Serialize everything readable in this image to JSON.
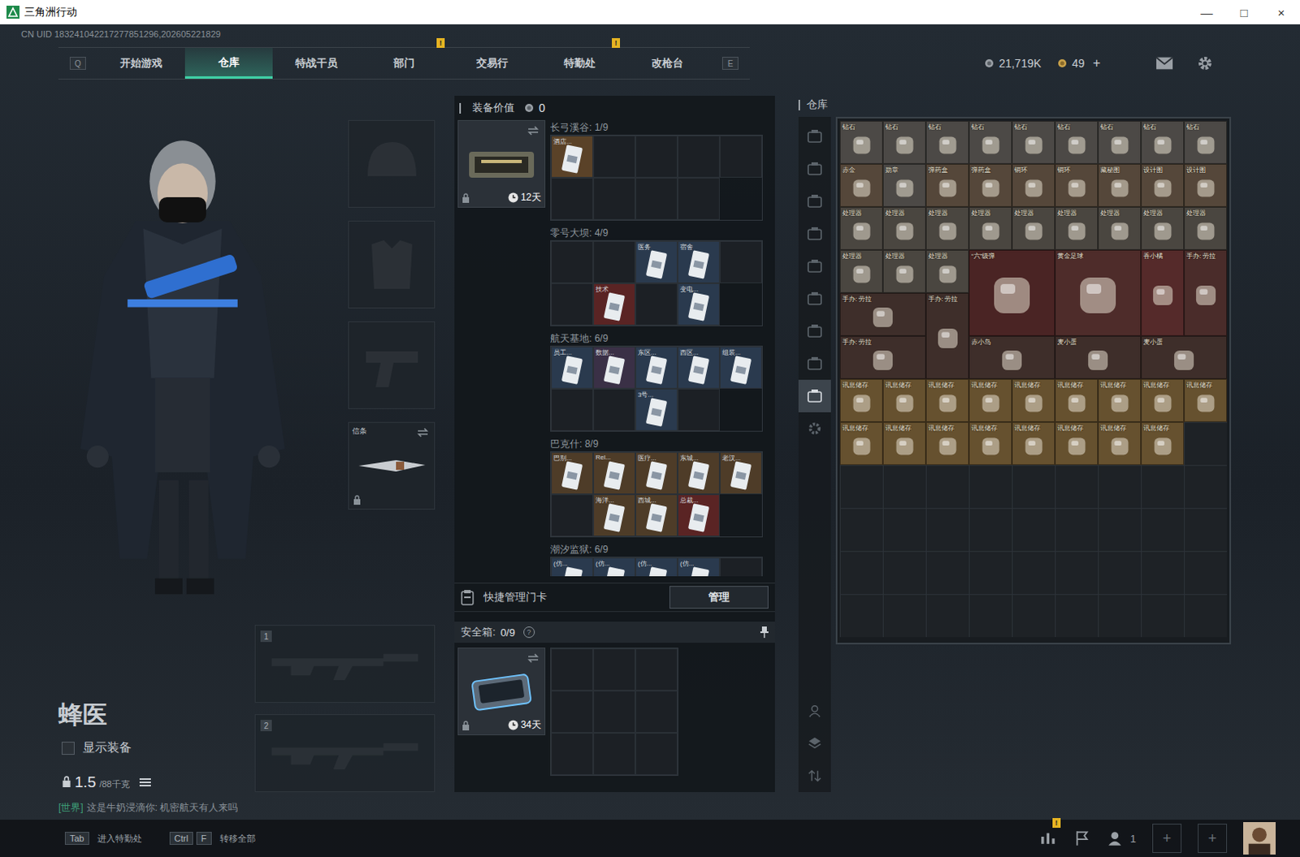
{
  "window": {
    "title": "三角洲行动",
    "controls": [
      "—",
      "□",
      "×"
    ]
  },
  "uid": "CN UID 183241042217277851296,202605221829",
  "nav": {
    "left_key": "Q",
    "right_key": "E",
    "alert_mark": "!",
    "tabs": [
      {
        "label": "开始游戏",
        "selected": false,
        "alert": false
      },
      {
        "label": "仓库",
        "selected": true,
        "alert": false
      },
      {
        "label": "特战干员",
        "selected": false,
        "alert": false
      },
      {
        "label": "部门",
        "selected": false,
        "alert": true
      },
      {
        "label": "交易行",
        "selected": false,
        "alert": false
      },
      {
        "label": "特勤处",
        "selected": false,
        "alert": true
      },
      {
        "label": "改枪台",
        "selected": false,
        "alert": false
      }
    ]
  },
  "currency": {
    "coins": "21,719K",
    "tickets": "49",
    "add": "+"
  },
  "operator": {
    "name": "蜂医",
    "show_equipment": {
      "label": "显示装备",
      "checked": false
    },
    "weight": "1.5",
    "weight_max": "/88千克"
  },
  "chat": {
    "channel": "[世界]",
    "message": "这是牛奶浸滴你: 机密航天有人来吗"
  },
  "equipment": {
    "slots": [
      {
        "kind": "helmet",
        "label": "",
        "locked": false
      },
      {
        "kind": "armor",
        "label": "",
        "locked": false
      },
      {
        "kind": "pistol",
        "label": "",
        "locked": false
      },
      {
        "kind": "melee",
        "label": "信条",
        "locked": true
      }
    ],
    "weapons": [
      {
        "number": "1"
      },
      {
        "number": "2"
      }
    ]
  },
  "loadout": {
    "value_label": "装备价值",
    "value": "0",
    "keycard_holder": {
      "timer": "12天",
      "locked": true
    },
    "maps": [
      {
        "title": "长弓溪谷: 1/9",
        "slots": [
          {
            "label": "酒店...",
            "filled": true,
            "color": "#5a4228"
          },
          {
            "label": "",
            "filled": false
          },
          {
            "label": "",
            "filled": false
          },
          {
            "label": "",
            "filled": false
          },
          {
            "label": "",
            "filled": false
          },
          {
            "label": "",
            "filled": false
          },
          {
            "label": "",
            "filled": false
          },
          {
            "label": "",
            "filled": false
          },
          {
            "label": "",
            "filled": false
          }
        ]
      },
      {
        "title": "零号大坝: 4/9",
        "slots": [
          {
            "label": "",
            "filled": false
          },
          {
            "label": "",
            "filled": false
          },
          {
            "label": "医务",
            "filled": true,
            "color": "#2a3a4e"
          },
          {
            "label": "宿舍",
            "filled": true,
            "color": "#2a3a4e"
          },
          {
            "label": "",
            "filled": false
          },
          {
            "label": "",
            "filled": false
          },
          {
            "label": "技术",
            "filled": true,
            "color": "#5a2424"
          },
          {
            "label": "",
            "filled": false
          },
          {
            "label": "变电...",
            "filled": true,
            "color": "#2a3a4e"
          }
        ]
      },
      {
        "title": "航天基地: 6/9",
        "slots": [
          {
            "label": "员工...",
            "filled": true,
            "color": "#2a3a4e"
          },
          {
            "label": "数据...",
            "filled": true,
            "color": "#3a3046"
          },
          {
            "label": "东区...",
            "filled": true,
            "color": "#2a3a4e"
          },
          {
            "label": "西区...",
            "filled": true,
            "color": "#2a3a4e"
          },
          {
            "label": "组装...",
            "filled": true,
            "color": "#2a3a4e"
          },
          {
            "label": "",
            "filled": false
          },
          {
            "label": "",
            "filled": false
          },
          {
            "label": "3号...",
            "filled": true,
            "color": "#2a3a4e"
          },
          {
            "label": "",
            "filled": false
          }
        ]
      },
      {
        "title": "巴克什: 8/9",
        "slots": [
          {
            "label": "巴别...",
            "filled": true,
            "color": "#4e3c28"
          },
          {
            "label": "Rel...",
            "filled": true,
            "color": "#4e3c28"
          },
          {
            "label": "医疗...",
            "filled": true,
            "color": "#4e3c28"
          },
          {
            "label": "东城...",
            "filled": true,
            "color": "#4e3c28"
          },
          {
            "label": "老汉...",
            "filled": true,
            "color": "#4e3c28"
          },
          {
            "label": "",
            "filled": false
          },
          {
            "label": "海洋...",
            "filled": true,
            "color": "#4e3c28"
          },
          {
            "label": "西城...",
            "filled": true,
            "color": "#4e3c28"
          },
          {
            "label": "总裁...",
            "filled": true,
            "color": "#5a2424"
          }
        ]
      },
      {
        "title": "潮汐监狱: 6/9",
        "slots": [
          {
            "label": "(仿...",
            "filled": true,
            "color": "#2a3a4e"
          },
          {
            "label": "(仿...",
            "filled": true,
            "color": "#2a3a4e"
          },
          {
            "label": "(仿...",
            "filled": true,
            "color": "#2a3a4e"
          },
          {
            "label": "(仿...",
            "filled": true,
            "color": "#2a3a4e"
          },
          {
            "label": "",
            "filled": false
          },
          {
            "label": "",
            "filled": false
          },
          {
            "label": "",
            "filled": false
          },
          {
            "label": "",
            "filled": false
          },
          {
            "label": "",
            "filled": false
          }
        ]
      }
    ],
    "quick_manage": {
      "label": "快捷管理门卡",
      "button": "管理"
    },
    "safebox": {
      "label": "安全箱:",
      "count": "0/9",
      "help": "?",
      "timer": "34天",
      "locked": true,
      "slots": 9
    }
  },
  "warehouse": {
    "title": "仓库",
    "sidebar": [
      {
        "selected": false
      },
      {
        "selected": false
      },
      {
        "selected": false
      },
      {
        "selected": false
      },
      {
        "selected": false
      },
      {
        "selected": false
      },
      {
        "selected": false
      },
      {
        "selected": false
      },
      {
        "selected": true
      }
    ],
    "items": [
      {
        "label": "钻石",
        "kind": "small",
        "color": "#4c4946"
      },
      {
        "label": "钻石",
        "kind": "small",
        "color": "#4c4946"
      },
      {
        "label": "钻石",
        "kind": "small",
        "color": "#4c4946"
      },
      {
        "label": "钻石",
        "kind": "small",
        "color": "#4c4946"
      },
      {
        "label": "钻石",
        "kind": "small",
        "color": "#4c4946"
      },
      {
        "label": "钻石",
        "kind": "small",
        "color": "#4c4946"
      },
      {
        "label": "钻石",
        "kind": "small",
        "color": "#4c4946"
      },
      {
        "label": "钻石",
        "kind": "small",
        "color": "#4c4946"
      },
      {
        "label": "钻石",
        "kind": "small",
        "color": "#4c4946"
      },
      {
        "label": "赤金",
        "kind": "small",
        "color": "#55473a"
      },
      {
        "label": "勋章",
        "kind": "small",
        "color": "#4c4946"
      },
      {
        "label": "弹药盒",
        "kind": "small",
        "color": "#55473a"
      },
      {
        "label": "弹药盒",
        "kind": "small",
        "color": "#55473a"
      },
      {
        "label": "铜环",
        "kind": "small",
        "color": "#55473a"
      },
      {
        "label": "铜环",
        "kind": "small",
        "color": "#55473a"
      },
      {
        "label": "藏秘图",
        "kind": "small",
        "color": "#55473a"
      },
      {
        "label": "设计图",
        "kind": "small",
        "color": "#55473a"
      },
      {
        "label": "设计图",
        "kind": "small",
        "color": "#55473a"
      },
      {
        "label": "处理器",
        "kind": "small",
        "color": "#4a4640"
      },
      {
        "label": "处理器",
        "kind": "small",
        "color": "#4a4640"
      },
      {
        "label": "处理器",
        "kind": "small",
        "color": "#4a4640"
      },
      {
        "label": "处理器",
        "kind": "small",
        "color": "#4a4640"
      },
      {
        "label": "处理器",
        "kind": "small",
        "color": "#4a4640"
      },
      {
        "label": "处理器",
        "kind": "small",
        "color": "#4a4640"
      },
      {
        "label": "处理器",
        "kind": "small",
        "color": "#4a4640"
      },
      {
        "label": "处理器",
        "kind": "small",
        "color": "#4a4640"
      },
      {
        "label": "处理器",
        "kind": "small",
        "color": "#4a4640"
      },
      {
        "label": "处理器",
        "kind": "small",
        "color": "#4a4640"
      },
      {
        "label": "处理器",
        "kind": "small",
        "color": "#4a4640"
      },
      {
        "label": "处理器",
        "kind": "small",
        "color": "#4a4640"
      },
      {
        "label": "“六”级弹",
        "kind": "large",
        "color": "#4a2424"
      },
      {
        "label": "黄金足球",
        "kind": "large",
        "color": "#4e2c2a"
      },
      {
        "label": "香小橘",
        "kind": "tall",
        "color": "#552a2a"
      },
      {
        "label": "手办: 劳拉",
        "kind": "tall",
        "color": "#4a2c2a"
      },
      {
        "label": "手办: 劳拉",
        "kind": "wide",
        "color": "#3e2e2a"
      },
      {
        "label": "手办: 劳拉",
        "kind": "tall",
        "color": "#3e2e2a"
      },
      {
        "label": "手办: 劳拉",
        "kind": "wide",
        "color": "#3e2e2a"
      },
      {
        "label": "赤小鸟",
        "kind": "wide",
        "color": "#3e2e2a"
      },
      {
        "label": "麦小蛋",
        "kind": "wide",
        "color": "#3e2e2a"
      },
      {
        "label": "麦小蛋",
        "kind": "wide",
        "color": "#3e2e2a"
      },
      {
        "label": "讯息储存",
        "kind": "small",
        "color": "#66512f"
      },
      {
        "label": "讯息储存",
        "kind": "small",
        "color": "#66512f"
      },
      {
        "label": "讯息储存",
        "kind": "small",
        "color": "#66512f"
      },
      {
        "label": "讯息储存",
        "kind": "small",
        "color": "#66512f"
      },
      {
        "label": "讯息储存",
        "kind": "small",
        "color": "#66512f"
      },
      {
        "label": "讯息储存",
        "kind": "small",
        "color": "#66512f"
      },
      {
        "label": "讯息储存",
        "kind": "small",
        "color": "#66512f"
      },
      {
        "label": "讯息储存",
        "kind": "small",
        "color": "#66512f"
      },
      {
        "label": "讯息储存",
        "kind": "small",
        "color": "#66512f"
      },
      {
        "label": "讯息储存",
        "kind": "small",
        "color": "#66512f"
      },
      {
        "label": "讯息储存",
        "kind": "small",
        "color": "#66512f"
      },
      {
        "label": "讯息储存",
        "kind": "small",
        "color": "#66512f"
      },
      {
        "label": "讯息储存",
        "kind": "small",
        "color": "#66512f"
      },
      {
        "label": "讯息储存",
        "kind": "small",
        "color": "#66512f"
      },
      {
        "label": "讯息储存",
        "kind": "small",
        "color": "#66512f"
      },
      {
        "label": "讯息储存",
        "kind": "small",
        "color": "#66512f"
      },
      {
        "label": "讯息储存",
        "kind": "small",
        "color": "#66512f"
      }
    ]
  },
  "bottom_bar": {
    "hints": [
      {
        "keys": [
          "Tab"
        ],
        "label": "进入特勤处"
      },
      {
        "keys": [
          "Ctrl",
          "F"
        ],
        "label": "转移全部"
      }
    ],
    "alert_mark": "!",
    "friends": "1",
    "add_slots": [
      "+",
      "+"
    ]
  }
}
